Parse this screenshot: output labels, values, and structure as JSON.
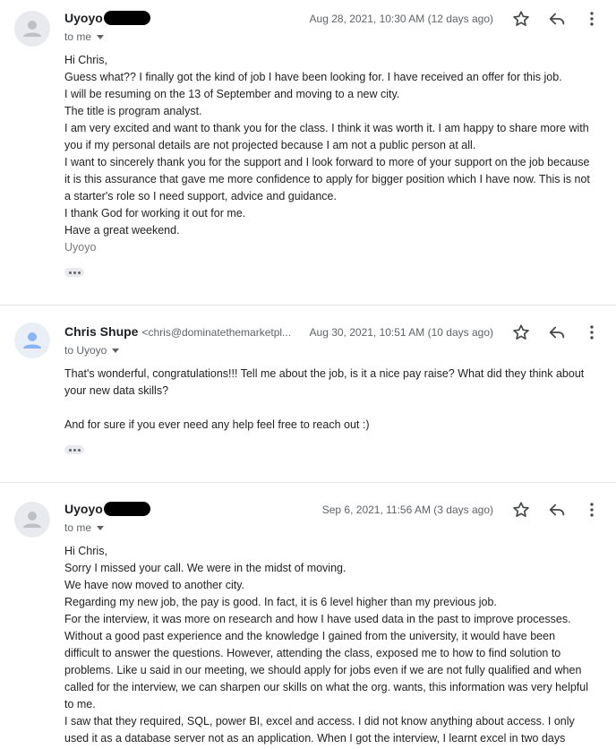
{
  "messages": [
    {
      "sender": "Uyoyo",
      "sender_email": "",
      "to": "to me",
      "date": "Aug 28, 2021, 10:30 AM (12 days ago)",
      "body": [
        "Hi Chris,",
        "Guess what?? I finally got the kind of job I have been looking for. I have received an offer for this job.",
        "I will be resuming on the 13 of September and moving to a new city.",
        "The title is program analyst.",
        "I am very excited and want to thank you for the class. I think it was worth it. I am happy to share more with you if my personal details are not projected because I am not a public person at all.",
        "I want to sincerely thank you for the support and I look forward to more of your support on the job because it is this assurance that gave me more confidence to apply for bigger position which I have now. This is not a starter's role so I need support, advice and guidance.",
        "I thank God for working it out for me.",
        "Have a great weekend."
      ],
      "signature": "Uyoyo"
    },
    {
      "sender": "Chris Shupe",
      "sender_email": "<chris@dominatethemarketpl...",
      "to": "to Uyoyo",
      "date": "Aug 30, 2021, 10:51 AM (10 days ago)",
      "body": [
        "That's wonderful, congratulations!!! Tell me about the job, is it a nice pay raise? What did they think about your new data skills?",
        "",
        "And for sure if you ever need any help feel free to reach out :)"
      ],
      "signature": ""
    },
    {
      "sender": "Uyoyo",
      "sender_email": "",
      "to": "to me",
      "date": "Sep 6, 2021, 11:56 AM (3 days ago)",
      "body": [
        "Hi Chris,",
        "Sorry I missed your call. We were in the midst of moving.",
        "We have now moved to another city.",
        "Regarding my new job, the pay is good. In fact, it is 6 level higher than my previous job.",
        "For the interview, it was more on research and how I have used data in the past to improve processes. Without a good past experience and the knowledge I gained from the university, it would have been difficult to answer the questions. However, attending the class, exposed me to how to find solution to problems. Like u said in our meeting, we should apply for jobs even if we are not fully qualified and when called for the interview, we can sharpen our skills on what the org. wants, this information was very helpful to me.",
        "I saw that they required, SQL, power BI, excel and access. I did not know anything about access. I only used it as a database server not as an application. When I got the interview, I learnt excel in two days"
      ],
      "signature": ""
    }
  ],
  "icons": {
    "star": "star-icon",
    "reply": "reply-icon",
    "more": "more-vert-icon",
    "avatar": "person-icon",
    "expand": "ellipsis-icon"
  },
  "colors": {
    "avatar_gray": "#e8eaed",
    "avatar_blue": "#e9eef7",
    "muted_text": "#5f6368",
    "body_text": "#222222",
    "signature": "#777777",
    "divider": "#e4e4e4"
  }
}
